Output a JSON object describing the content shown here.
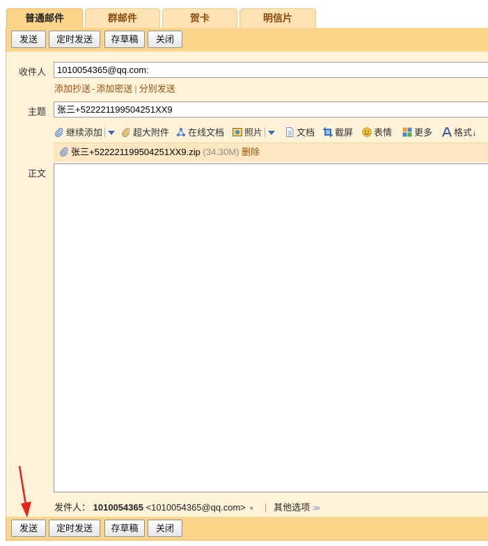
{
  "tabs": [
    {
      "label": "普通邮件",
      "active": true
    },
    {
      "label": "群邮件",
      "active": false
    },
    {
      "label": "贺卡",
      "active": false
    },
    {
      "label": "明信片",
      "active": false
    }
  ],
  "toolbar": {
    "send_label": "发送",
    "scheduled_send_label": "定时发送",
    "save_draft_label": "存草稿",
    "close_label": "关闭"
  },
  "recipient": {
    "label": "收件人",
    "value": "1010054365@qq.com",
    "separator": ";"
  },
  "recipient_links": {
    "add_cc": "添加抄送",
    "dash": "-",
    "add_bcc": "添加密送",
    "separate_send": "分别发送"
  },
  "subject": {
    "label": "主题",
    "value": "张三+522221199504251XX9"
  },
  "attach_tools": [
    {
      "label": "继续添加",
      "icon": "paperclip-icon"
    },
    {
      "label": "超大附件",
      "icon": "paperclip-icon"
    },
    {
      "label": "在线文档",
      "icon": "share-nodes-icon"
    },
    {
      "label": "照片",
      "icon": "photo-icon"
    },
    {
      "label": "文档",
      "icon": "document-icon"
    },
    {
      "label": "截屏",
      "icon": "screenshot-icon"
    },
    {
      "label": "表情",
      "icon": "smiley-icon"
    },
    {
      "label": "更多",
      "icon": "grid-icon"
    },
    {
      "label": "格式↓",
      "icon": "font-format-icon"
    }
  ],
  "attachment": {
    "filename": "张三+522221199504251XX9.zip",
    "size": "(34.30M)",
    "delete_label": "删除"
  },
  "body": {
    "label": "正文",
    "value": ""
  },
  "sender": {
    "label": "发件人：",
    "name": "1010054365",
    "address": "<1010054365@qq.com>",
    "dropdown": "▼",
    "pipe": "|",
    "other_options": "其他选项",
    "other_options_icon": "≫"
  },
  "colors": {
    "accent_bar": "#fcd58b",
    "panel_bg": "#fef2d9",
    "link": "#9c4f0a",
    "arrow": "#e8241a"
  }
}
